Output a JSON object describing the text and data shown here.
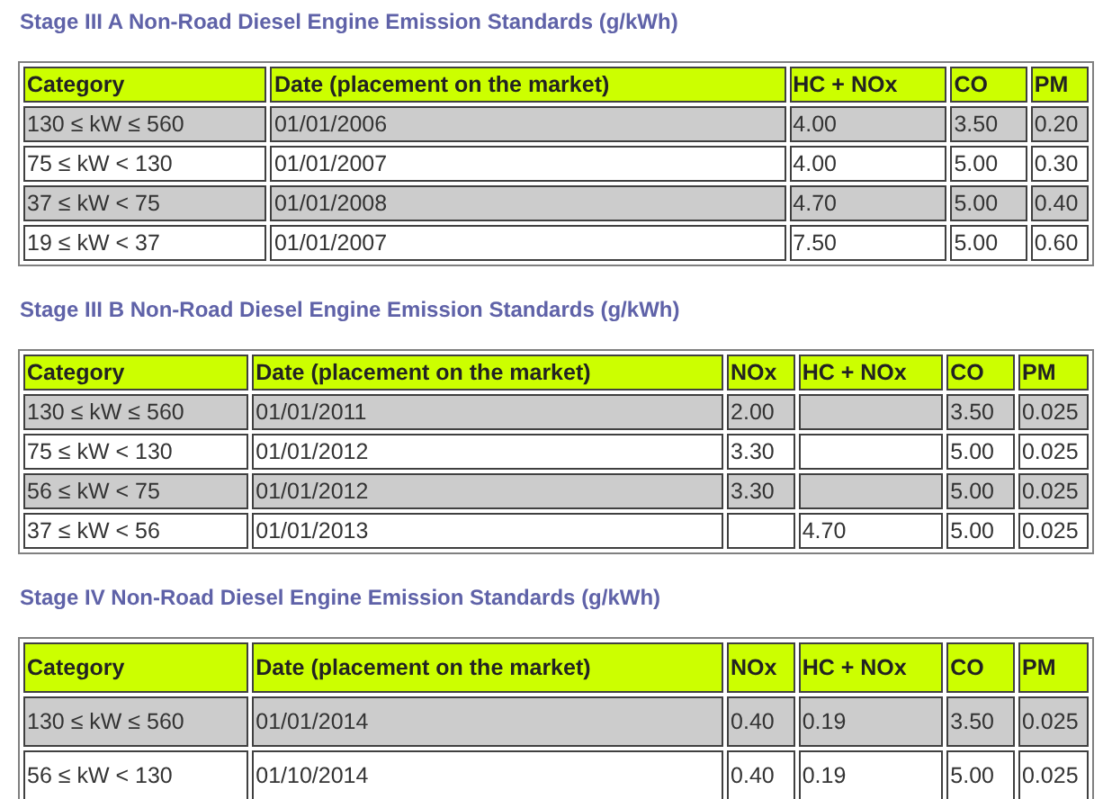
{
  "sections": [
    {
      "title": "Stage III A Non-Road Diesel Engine Emission Standards (g/kWh)",
      "columns": [
        "Category",
        "Date (placement on the market)",
        "HC + NOx",
        "CO",
        "PM"
      ],
      "rows": [
        [
          "130 ≤ kW ≤ 560",
          "01/01/2006",
          "4.00",
          "3.50",
          "0.20"
        ],
        [
          "75 ≤ kW < 130",
          "01/01/2007",
          "4.00",
          "5.00",
          "0.30"
        ],
        [
          "37 ≤ kW < 75",
          "01/01/2008",
          "4.70",
          "5.00",
          "0.40"
        ],
        [
          "19 ≤ kW < 37",
          "01/01/2007",
          "7.50",
          "5.00",
          "0.60"
        ]
      ]
    },
    {
      "title": "Stage III B Non-Road Diesel Engine Emission Standards (g/kWh)",
      "columns": [
        "Category",
        "Date (placement on the market)",
        "NOx",
        "HC + NOx",
        "CO",
        "PM"
      ],
      "rows": [
        [
          "130 ≤ kW ≤ 560",
          "01/01/2011",
          "2.00",
          null,
          "3.50",
          "0.025"
        ],
        [
          "75 ≤ kW < 130",
          "01/01/2012",
          "3.30",
          null,
          "5.00",
          "0.025"
        ],
        [
          "56 ≤ kW < 75",
          "01/01/2012",
          "3.30",
          null,
          "5.00",
          "0.025"
        ],
        [
          "37 ≤ kW < 56",
          "01/01/2013",
          null,
          "4.70",
          "5.00",
          "0.025"
        ]
      ]
    },
    {
      "title": "Stage IV Non-Road Diesel Engine Emission Standards (g/kWh)",
      "columns": [
        "Category",
        "Date (placement on the market)",
        "NOx",
        "HC + NOx",
        "CO",
        "PM"
      ],
      "rows": [
        [
          "130 ≤ kW ≤ 560",
          "01/01/2014",
          "0.40",
          "0.19",
          "3.50",
          "0.025"
        ],
        [
          "56 ≤ kW < 130",
          "01/10/2014",
          "0.40",
          "0.19",
          "5.00",
          "0.025"
        ]
      ]
    }
  ]
}
